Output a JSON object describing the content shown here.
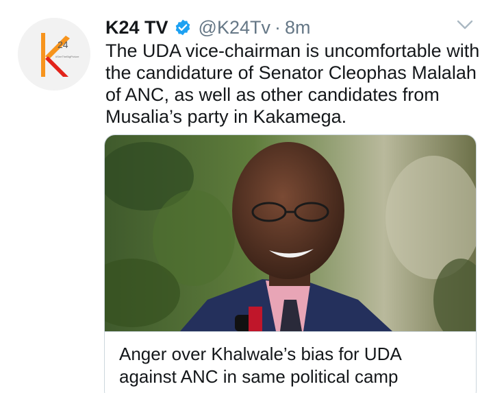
{
  "tweet": {
    "author_name": "K24 TV",
    "handle": "@K24Tv",
    "separator": "·",
    "time": "8m",
    "text": "The UDA vice-chairman is uncomfortable with the candidature of Senator Cleophas Malalah of ANC, as well as other candidates from Musalia’s party in Kakamega.",
    "avatar": {
      "logo_text": "24",
      "tagline": "#SeeTheBigPicture"
    },
    "icons": {
      "verified": "verified-badge-icon",
      "menu": "chevron-down-icon"
    },
    "colors": {
      "verified": "#1da1f2",
      "secondary_text": "#657786",
      "border": "#ccd6dd",
      "logo_orange": "#f7941d",
      "logo_red": "#e2231a"
    }
  },
  "card": {
    "title": "Anger over Khalwale’s bias for UDA against ANC in same political camp"
  }
}
